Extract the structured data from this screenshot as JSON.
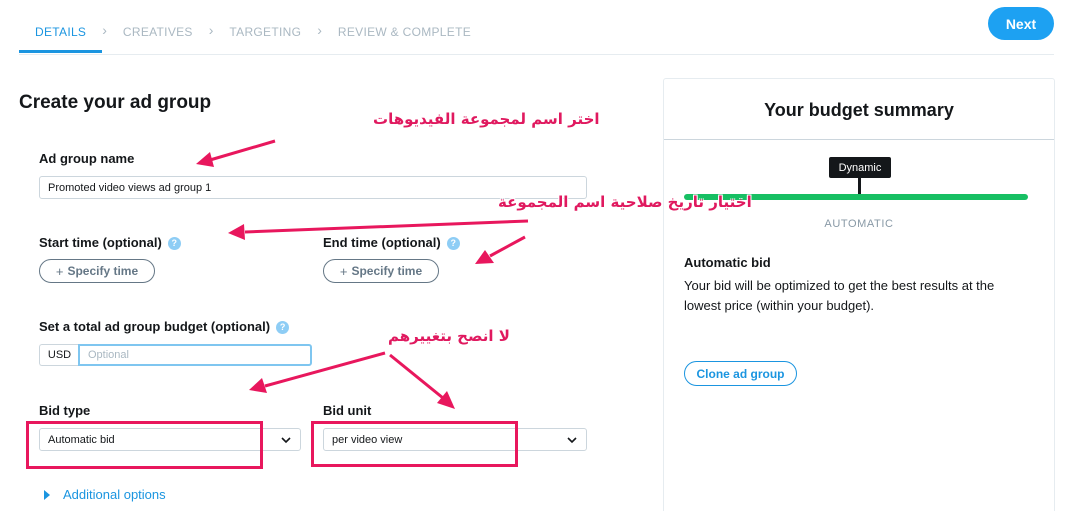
{
  "stepper": {
    "steps": [
      "DETAILS",
      "CREATIVES",
      "TARGETING",
      "REVIEW & COMPLETE"
    ],
    "next_label": "Next"
  },
  "form": {
    "title": "Create your ad group",
    "ad_group_name_label": "Ad group name",
    "ad_group_name_value": "Promoted video views ad group 1",
    "start_time_label": "Start time (optional)",
    "end_time_label": "End time (optional)",
    "specify_time_label": "Specify time",
    "budget_label": "Set a total ad group budget (optional)",
    "currency": "USD",
    "budget_placeholder": "Optional",
    "bid_type_label": "Bid type",
    "bid_type_value": "Automatic bid",
    "bid_unit_label": "Bid unit",
    "bid_unit_value": "per video view",
    "additional_options": "Additional options"
  },
  "summary": {
    "title": "Your budget summary",
    "tooltip": "Dynamic",
    "mode": "AUTOMATIC",
    "bid_title": "Automatic bid",
    "bid_description": "Your bid will be optimized to get the best results at the lowest price (within your budget).",
    "clone_label": "Clone ad group"
  },
  "annotations": {
    "name_note": "اختر اسم لمجموعة الفيديوهات",
    "date_note": "اختيار تاريخ صلاحية اسم المجموعة",
    "bid_note": "لا انصح بتغييرهم",
    "color": "#e8175d"
  }
}
